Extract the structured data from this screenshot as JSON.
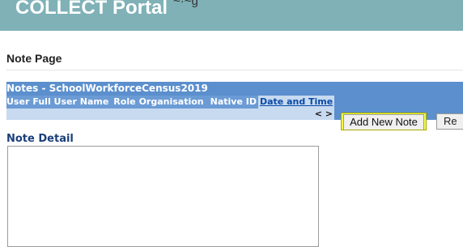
{
  "header": {
    "portal_title": "COLLECT Portal",
    "cropped_fragment": "~·~g"
  },
  "page": {
    "heading": "Note Page"
  },
  "notes_grid": {
    "title": "Notes - SchoolWorkforceCensus2019",
    "columns": [
      "User",
      "Full User Name",
      "Role",
      "Organisation",
      "Native ID",
      "Date and Time"
    ],
    "pager": "< >"
  },
  "buttons": {
    "add_new_note": "Add New Note",
    "second_button_partial": "Re"
  },
  "note_detail": {
    "heading": "Note Detail",
    "value": ""
  },
  "colors": {
    "banner": "#7fb1b7",
    "grid_header": "#5b8fcd",
    "highlight": "#f5ff3d",
    "link": "#0b4aa8"
  }
}
